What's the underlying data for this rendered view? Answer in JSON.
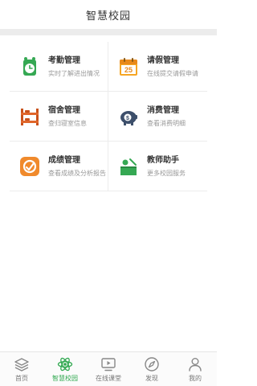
{
  "header": {
    "title": "智慧校园"
  },
  "features": [
    {
      "title": "考勤管理",
      "subtitle": "实时了解进出情况",
      "icon": "attendance-clock-icon"
    },
    {
      "title": "请假管理",
      "subtitle": "在线提交请假申请",
      "icon": "calendar-25-icon"
    },
    {
      "title": "宿舍管理",
      "subtitle": "查归寝室信息",
      "icon": "bunk-bed-icon"
    },
    {
      "title": "消费管理",
      "subtitle": "查看消费明细",
      "icon": "piggy-bank-icon"
    },
    {
      "title": "成绩管理",
      "subtitle": "查看成绩及分析报告",
      "icon": "grade-report-icon"
    },
    {
      "title": "教师助手",
      "subtitle": "更多校园服务",
      "icon": "teacher-desk-icon"
    }
  ],
  "tabbar": {
    "items": [
      {
        "label": "首页",
        "icon": "stack-home-icon"
      },
      {
        "label": "智慧校园",
        "icon": "atom-campus-icon",
        "active": true
      },
      {
        "label": "在线课堂",
        "icon": "video-play-icon"
      },
      {
        "label": "发现",
        "icon": "compass-icon"
      },
      {
        "label": "我的",
        "icon": "person-icon"
      }
    ],
    "active_color": "#2fa84f"
  }
}
